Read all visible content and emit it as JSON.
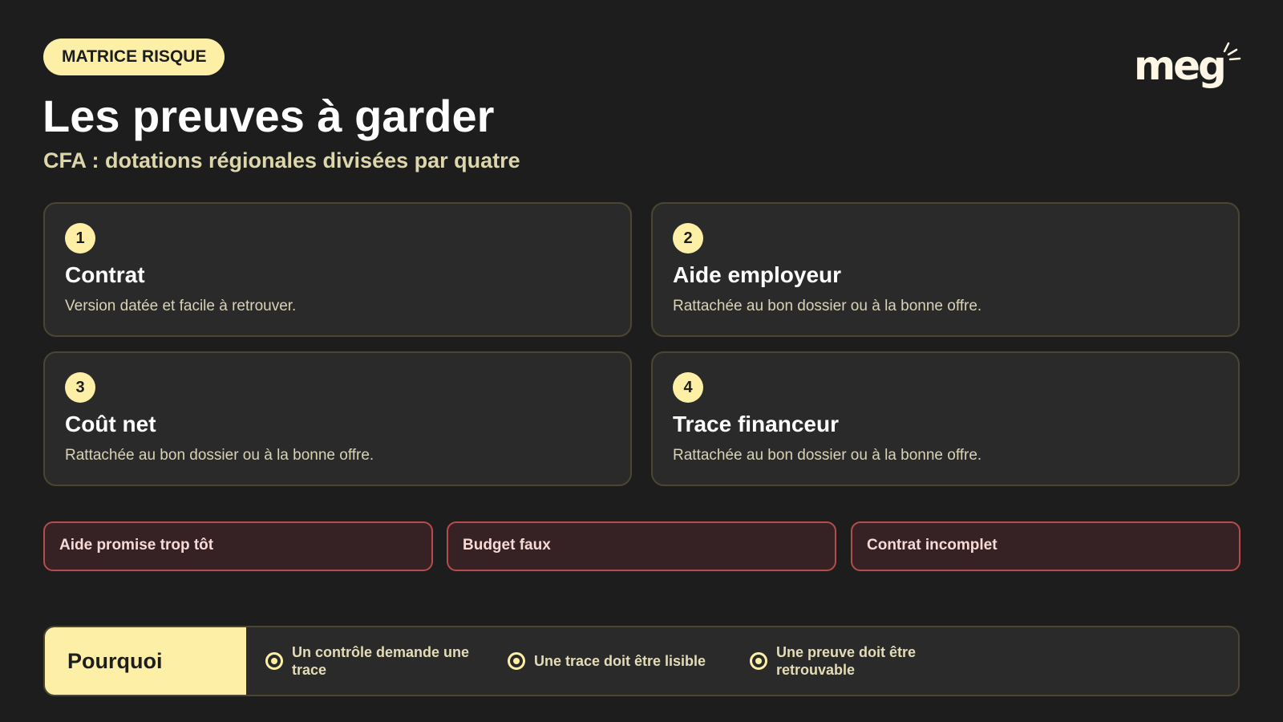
{
  "header": {
    "badge": "MATRICE RISQUE",
    "title": "Les preuves à garder",
    "subtitle": "CFA : dotations régionales divisées par quatre",
    "logo_text": "meg"
  },
  "cards": [
    {
      "num": "1",
      "title": "Contrat",
      "desc": "Version datée et facile à retrouver."
    },
    {
      "num": "2",
      "title": "Aide employeur",
      "desc": "Rattachée au bon dossier ou à la bonne offre."
    },
    {
      "num": "3",
      "title": "Coût net",
      "desc": "Rattachée au bon dossier ou à la bonne offre."
    },
    {
      "num": "4",
      "title": "Trace financeur",
      "desc": "Rattachée au bon dossier ou à la bonne offre."
    }
  ],
  "risks": [
    "Aide promise trop tôt",
    "Budget faux",
    "Contrat incomplet"
  ],
  "why": {
    "label": "Pourquoi",
    "items": [
      "Un contrôle demande une trace",
      "Une trace doit être lisible",
      "Une preuve doit être retrouvable"
    ]
  },
  "colors": {
    "background": "#1d1d1e",
    "accent": "#fdf0a6",
    "risk_border": "#b54d4c",
    "risk_bg": "#362224"
  }
}
